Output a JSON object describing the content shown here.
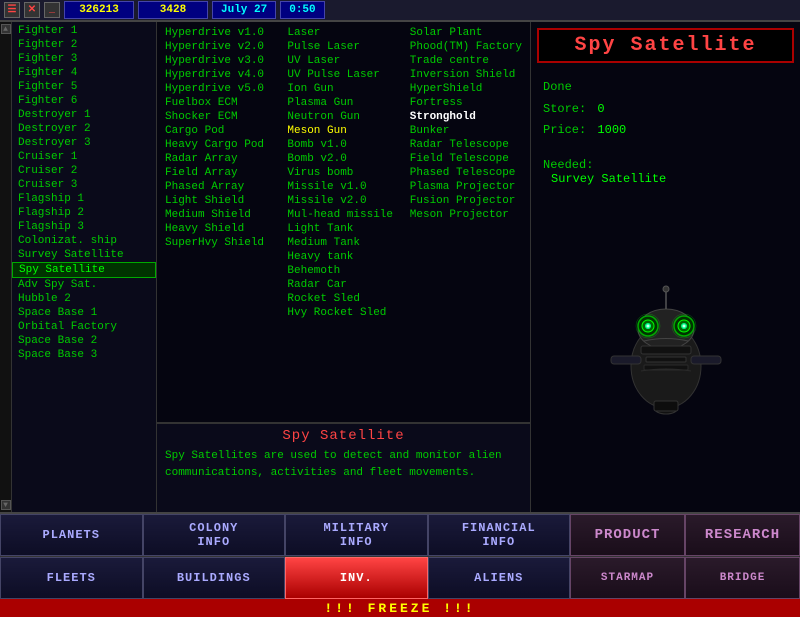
{
  "topbar": {
    "resource": "326213",
    "resource2": "3428",
    "date": "July  27",
    "time": "0:50"
  },
  "ships": [
    {
      "label": "Fighter 1",
      "selected": false
    },
    {
      "label": "Fighter 2",
      "selected": false
    },
    {
      "label": "Fighter 3",
      "selected": false
    },
    {
      "label": "Fighter 4",
      "selected": false
    },
    {
      "label": "Fighter 5",
      "selected": false
    },
    {
      "label": "Fighter 6",
      "selected": false
    },
    {
      "label": "Destroyer 1",
      "selected": false
    },
    {
      "label": "Destroyer 2",
      "selected": false
    },
    {
      "label": "Destroyer 3",
      "selected": false
    },
    {
      "label": "Cruiser 1",
      "selected": false
    },
    {
      "label": "Cruiser 2",
      "selected": false
    },
    {
      "label": "Cruiser 3",
      "selected": false
    },
    {
      "label": "Flagship 1",
      "selected": false
    },
    {
      "label": "Flagship 2",
      "selected": false
    },
    {
      "label": "Flagship 3",
      "selected": false
    },
    {
      "label": "Colonizat. ship",
      "selected": false
    },
    {
      "label": "Survey Satellite",
      "selected": false
    },
    {
      "label": "Spy Satellite",
      "selected": true
    },
    {
      "label": "Adv Spy Sat.",
      "selected": false
    },
    {
      "label": "Hubble 2",
      "selected": false
    },
    {
      "label": "Space Base 1",
      "selected": false
    },
    {
      "label": "Orbital Factory",
      "selected": false
    },
    {
      "label": "Space Base 2",
      "selected": false
    },
    {
      "label": "Space Base 3",
      "selected": false
    }
  ],
  "equipment": {
    "col1": [
      {
        "label": "Hyperdrive v1.0",
        "type": "normal"
      },
      {
        "label": "Hyperdrive v2.0",
        "type": "normal"
      },
      {
        "label": "Hyperdrive v3.0",
        "type": "normal"
      },
      {
        "label": "Hyperdrive v4.0",
        "type": "normal"
      },
      {
        "label": "Hyperdrive v5.0",
        "type": "normal"
      },
      {
        "label": "Fuelbox ECM",
        "type": "normal"
      },
      {
        "label": "Shocker ECM",
        "type": "normal"
      },
      {
        "label": "Cargo Pod",
        "type": "normal"
      },
      {
        "label": "Heavy Cargo Pod",
        "type": "normal"
      },
      {
        "label": "Radar Array",
        "type": "normal"
      },
      {
        "label": "Field Array",
        "type": "normal"
      },
      {
        "label": "Phased Array",
        "type": "normal"
      },
      {
        "label": "Light Shield",
        "type": "normal"
      },
      {
        "label": "Medium Shield",
        "type": "normal"
      },
      {
        "label": "Heavy Shield",
        "type": "normal"
      },
      {
        "label": "SuperHvy Shield",
        "type": "normal"
      }
    ],
    "col2": [
      {
        "label": "Laser",
        "type": "normal"
      },
      {
        "label": "Pulse Laser",
        "type": "normal"
      },
      {
        "label": "UV Laser",
        "type": "normal"
      },
      {
        "label": "UV Pulse Laser",
        "type": "normal"
      },
      {
        "label": "Ion Gun",
        "type": "normal"
      },
      {
        "label": "Plasma Gun",
        "type": "normal"
      },
      {
        "label": "Neutron Gun",
        "type": "normal"
      },
      {
        "label": "Meson Gun",
        "type": "yellow"
      },
      {
        "label": "Bomb v1.0",
        "type": "normal"
      },
      {
        "label": "Bomb v2.0",
        "type": "normal"
      },
      {
        "label": "Virus bomb",
        "type": "normal"
      },
      {
        "label": "Missile v1.0",
        "type": "normal"
      },
      {
        "label": "Missile v2.0",
        "type": "normal"
      },
      {
        "label": "Mul-head missile",
        "type": "normal"
      },
      {
        "label": "Light Tank",
        "type": "normal"
      },
      {
        "label": "Medium Tank",
        "type": "normal"
      },
      {
        "label": "Heavy tank",
        "type": "normal"
      },
      {
        "label": "Behemoth",
        "type": "normal"
      },
      {
        "label": "Radar Car",
        "type": "normal"
      },
      {
        "label": "Rocket Sled",
        "type": "normal"
      },
      {
        "label": "Hvy Rocket Sled",
        "type": "normal"
      }
    ],
    "col3": [
      {
        "label": "Solar Plant",
        "type": "normal"
      },
      {
        "label": "Phood(TM) Factory",
        "type": "normal"
      },
      {
        "label": "Trade centre",
        "type": "normal"
      },
      {
        "label": "Inversion Shield",
        "type": "normal"
      },
      {
        "label": "HyperShield",
        "type": "normal"
      },
      {
        "label": "Fortress",
        "type": "normal"
      },
      {
        "label": "Stronghold",
        "type": "highlight"
      },
      {
        "label": "Bunker",
        "type": "normal"
      },
      {
        "label": "Radar Telescope",
        "type": "normal"
      },
      {
        "label": "Field Telescope",
        "type": "normal"
      },
      {
        "label": "Phased Telescope",
        "type": "normal"
      },
      {
        "label": "Plasma Projector",
        "type": "normal"
      },
      {
        "label": "Fusion Projector",
        "type": "normal"
      },
      {
        "label": "Meson Projector",
        "type": "normal"
      }
    ]
  },
  "detail": {
    "title": "Spy Satellite",
    "done_label": "Done",
    "store_label": "Store:",
    "store_value": "0",
    "price_label": "Price:",
    "price_value": "1000",
    "needed_label": "Needed:",
    "needed_value": "Survey Satellite"
  },
  "description": {
    "title": "Spy Satellite",
    "text": "Spy Satellites are used to detect and monitor alien communications, activities and fleet movements."
  },
  "bottom_buttons": [
    {
      "label": "PLANETS",
      "active": false
    },
    {
      "label": "COLONY\nINFO",
      "active": false
    },
    {
      "label": "MILITARY\nINFO",
      "active": false
    },
    {
      "label": "FINANCIAL\nINFO",
      "active": false
    },
    {
      "label": "PRODUCT",
      "active": false,
      "right": true
    },
    {
      "label": "RESEARCH",
      "active": false,
      "right": true
    }
  ],
  "bottom_row2": [
    {
      "label": "FLEETS",
      "active": false
    },
    {
      "label": "BUILDINGS",
      "active": false
    },
    {
      "label": "INV.",
      "active": true
    },
    {
      "label": "ALIENS",
      "active": false
    }
  ],
  "freeze_text": "!!! FREEZE !!!"
}
